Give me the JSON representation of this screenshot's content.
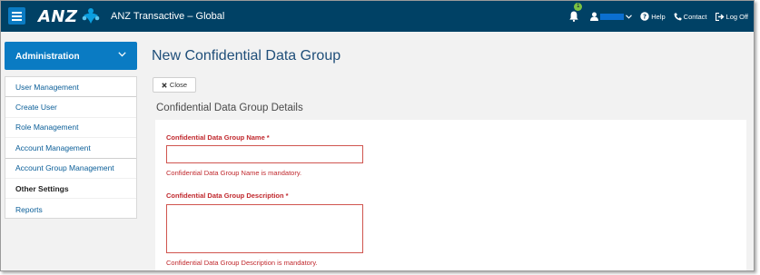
{
  "header": {
    "logo_text": "ANZ",
    "app_title": "ANZ Transactive – Global",
    "notification_count": "1",
    "help_label": "Help",
    "contact_label": "Contact",
    "logout_label": "Log Off",
    "colors": {
      "bar": "#004165",
      "accent": "#0a7bc3",
      "badge": "#7ac143"
    }
  },
  "sidebar": {
    "section_title": "Administration",
    "items": [
      {
        "label": "User Management"
      },
      {
        "label": "Create User"
      },
      {
        "label": "Role Management"
      },
      {
        "label": "Account Management"
      },
      {
        "label": "Account Group Management"
      },
      {
        "label": "Other Settings"
      },
      {
        "label": "Reports"
      }
    ]
  },
  "main": {
    "page_title": "New Confidential Data Group",
    "close_label": "Close",
    "section_title": "Confidential Data Group Details",
    "fields": [
      {
        "label": "Confidential Data Group Name",
        "required_mark": "*",
        "value": "",
        "error": "Confidential Data Group Name is mandatory."
      },
      {
        "label": "Confidential Data Group Description",
        "required_mark": "*",
        "value": "",
        "error": "Confidential Data Group Description is mandatory."
      }
    ]
  }
}
